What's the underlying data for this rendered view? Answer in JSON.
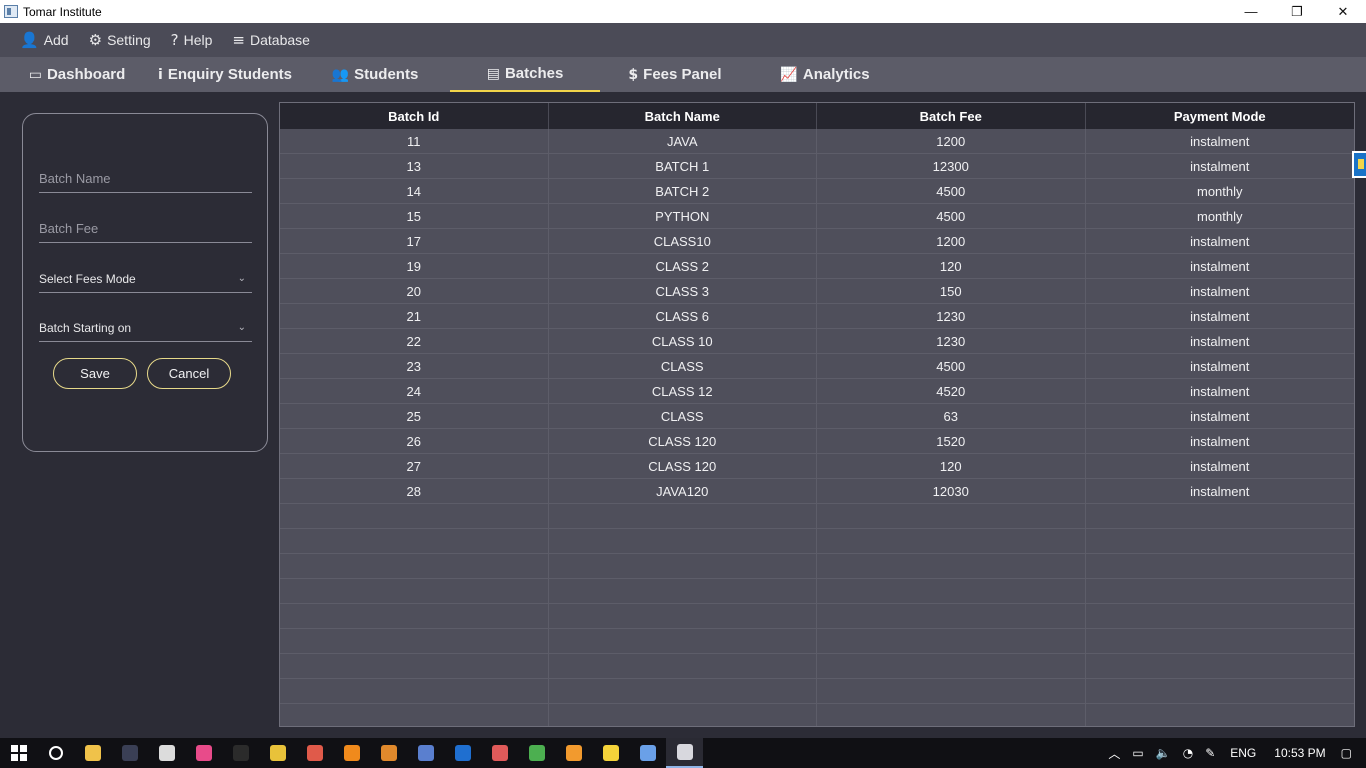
{
  "window": {
    "title": "Tomar Institute",
    "minimize": "—",
    "restore": "❐",
    "close": "✕"
  },
  "menu": [
    {
      "label": "Add",
      "icon": "👤"
    },
    {
      "label": "Setting",
      "icon": "⚙"
    },
    {
      "label": "Help",
      "icon": "?"
    },
    {
      "label": "Database",
      "icon": "≡"
    }
  ],
  "tabs": [
    {
      "label": "Dashboard",
      "icon": "▭"
    },
    {
      "label": "Enquiry Students",
      "icon": "i"
    },
    {
      "label": "Students",
      "icon": "👥"
    },
    {
      "label": "Batches",
      "icon": "▤",
      "active": true
    },
    {
      "label": "Fees Panel",
      "icon": "$"
    },
    {
      "label": "Analytics",
      "icon": "📈"
    }
  ],
  "form": {
    "batch_name_placeholder": "Batch Name",
    "batch_fee_placeholder": "Batch Fee",
    "fees_mode_value": "Select Fees Mode",
    "starting_on_value": "Batch Starting on",
    "save_label": "Save",
    "cancel_label": "Cancel"
  },
  "table": {
    "columns": [
      "Batch Id",
      "Batch Name",
      "Batch Fee",
      "Payment Mode"
    ],
    "rows": [
      [
        "11",
        "JAVA",
        "1200",
        "instalment"
      ],
      [
        "13",
        "BATCH 1",
        "12300",
        "instalment"
      ],
      [
        "14",
        "BATCH 2",
        "4500",
        "monthly"
      ],
      [
        "15",
        "PYTHON",
        "4500",
        "monthly"
      ],
      [
        "17",
        "CLASS10",
        "1200",
        "instalment"
      ],
      [
        "19",
        "CLASS 2",
        "120",
        "instalment"
      ],
      [
        "20",
        "CLASS 3",
        "150",
        "instalment"
      ],
      [
        "21",
        "CLASS 6",
        "1230",
        "instalment"
      ],
      [
        "22",
        "CLASS 10",
        "1230",
        "instalment"
      ],
      [
        "23",
        "CLASS",
        "4500",
        "instalment"
      ],
      [
        "24",
        "CLASS 12",
        "4520",
        "instalment"
      ],
      [
        "25",
        "CLASS",
        "63",
        "instalment"
      ],
      [
        "26",
        "CLASS 120",
        "1520",
        "instalment"
      ],
      [
        "27",
        "CLASS 120",
        "120",
        "instalment"
      ],
      [
        "28",
        "JAVA120",
        "12030",
        "instalment"
      ]
    ]
  },
  "taskbar": {
    "apps": [
      {
        "name": "file-explorer-icon",
        "color": "#f0c24a"
      },
      {
        "name": "terminal-icon",
        "color": "#3a3f55"
      },
      {
        "name": "maps-icon",
        "color": "#dcdcdc"
      },
      {
        "name": "paint-icon",
        "color": "#e84b8a"
      },
      {
        "name": "command-prompt-icon",
        "color": "#2b2b2b"
      },
      {
        "name": "tool-icon",
        "color": "#e8c23a"
      },
      {
        "name": "network-icon",
        "color": "#e05a4a"
      },
      {
        "name": "vlc-icon",
        "color": "#f08a1c"
      },
      {
        "name": "sublime-icon",
        "color": "#e0892c"
      },
      {
        "name": "mail-icon",
        "color": "#5a7fcf"
      },
      {
        "name": "app-h-icon",
        "color": "#1f6fd0"
      },
      {
        "name": "eraser-icon",
        "color": "#e05a5a"
      },
      {
        "name": "chrome-icon",
        "color": "#4caf50"
      },
      {
        "name": "settings-app-icon",
        "color": "#f29a2e"
      },
      {
        "name": "sticky-notes-icon",
        "color": "#f5d33a"
      },
      {
        "name": "virtualbox-icon",
        "color": "#6aa0e8"
      },
      {
        "name": "java-app-icon",
        "color": "#d8d8de",
        "active": true
      }
    ],
    "lang": "ENG",
    "time": "10:53 PM"
  }
}
